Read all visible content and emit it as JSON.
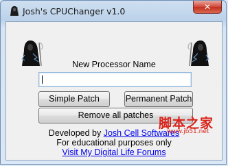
{
  "window": {
    "title": "Josh's CPUChanger v1.0",
    "close_label": "✕"
  },
  "form": {
    "label": "New Processor Name",
    "input_value": "",
    "simple_patch": "Simple Patch",
    "permanent_patch": "Permanent Patch",
    "remove_all_patches": "Remove all patches"
  },
  "credits": {
    "developed_by_prefix": "Developed by ",
    "developer_link": "Josh Cell Softwares",
    "educational": "For educational purposes only",
    "forum_link": "Visit My Digital Life Forums"
  },
  "icons": {
    "app": "grim-reaper-icon",
    "mascot": "grim-reaper-icon"
  },
  "watermark": {
    "text": "脚本之家",
    "url": "www.jb51.net"
  }
}
